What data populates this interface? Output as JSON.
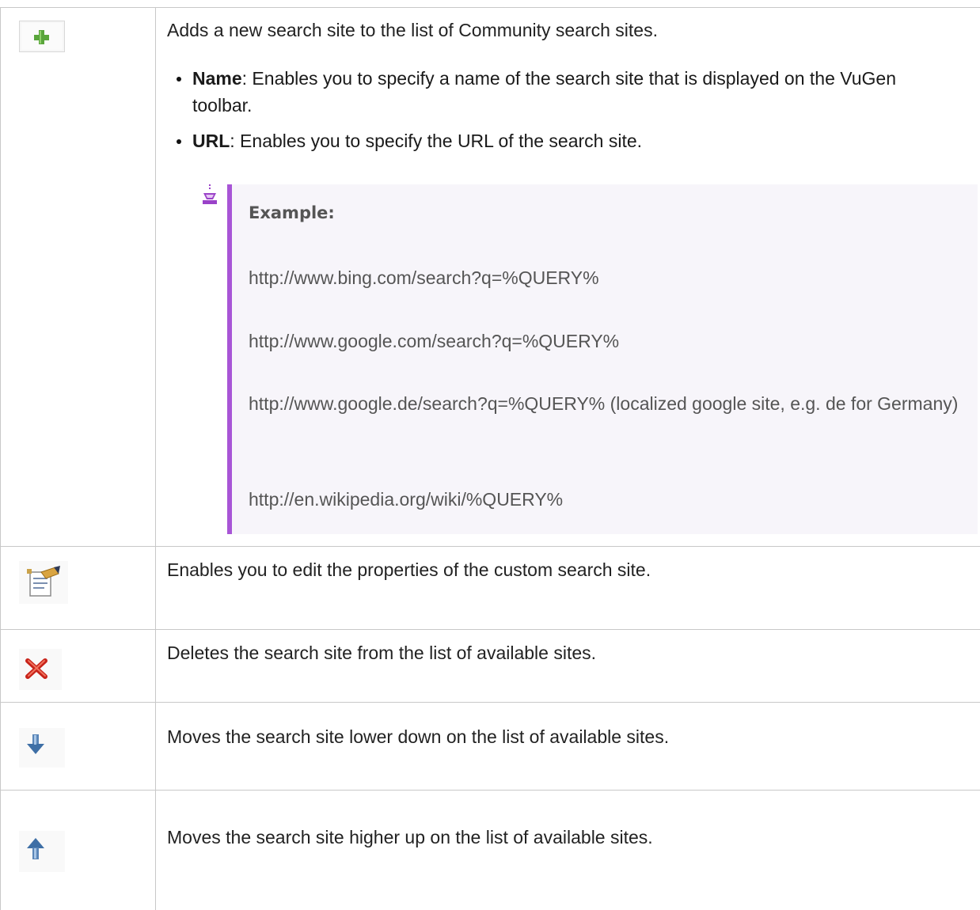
{
  "rows": [
    {
      "icon": "green-plus-icon",
      "description": "Adds a new search site to the list of Community search sites.",
      "options": [
        {
          "term": "Name",
          "text": ": Enables you to specify a name of the search site that is displayed on the VuGen toolbar."
        },
        {
          "term": "URL",
          "text": ": Enables you to specify the URL of the search site."
        }
      ],
      "example": {
        "icon": "example-icon",
        "heading": "Example:",
        "lines": [
          "http://www.bing.com/search?q=%QUERY%",
          "http://www.google.com/search?q=%QUERY%",
          "http://www.google.de/search?q=%QUERY%  (localized google site, e.g. de for Germany)",
          "http://en.wikipedia.org/wiki/%QUERY%"
        ],
        "accent_color": "#a855d6"
      }
    },
    {
      "icon": "edit-properties-icon",
      "description": "Enables you to edit the properties of the custom search site."
    },
    {
      "icon": "red-x-delete-icon",
      "description": "Deletes the search site from the list of available sites."
    },
    {
      "icon": "down-arrow-icon",
      "description": "Moves the search site lower down on the list of available sites."
    },
    {
      "icon": "up-arrow-icon",
      "description": "Moves the search site higher up on the list of available sites."
    }
  ]
}
